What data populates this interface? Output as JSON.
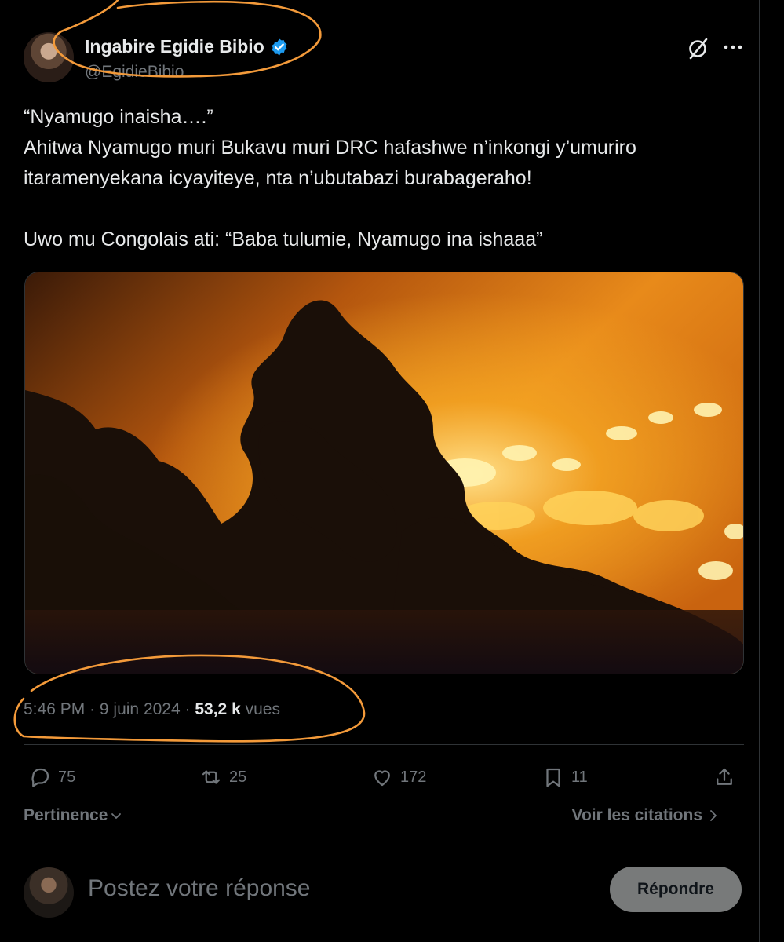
{
  "tweet": {
    "author": {
      "display_name": "Ingabire Egidie Bibio",
      "handle": "@EgidieBibio",
      "verified": true,
      "verified_color": "#1d9bf0"
    },
    "text_lines": [
      "“Nyamugo inaisha….”",
      "Ahitwa Nyamugo muri Bukavu muri DRC hafashwe n’inkongi y’umuriro",
      "itaramenyekana icyayiteye, nta n’ubutabazi burabageraho!",
      "Uwo mu Congolais ati: “Baba tulumie, Nyamugo ina ishaaa”"
    ],
    "media": {
      "kind": "video-still",
      "description_icon": "fire-scene"
    },
    "time": "5:46 PM",
    "date": "9 juin 2024",
    "separator": "·",
    "views_count": "53,2 k",
    "views_label": "vues"
  },
  "actions": {
    "replies": "75",
    "reposts": "25",
    "likes": "172",
    "bookmarks": "11"
  },
  "sort": {
    "label": "Pertinence",
    "chevron": "⌄"
  },
  "quotes_link": {
    "label": "Voir les citations",
    "chevron": "›"
  },
  "reply_box": {
    "placeholder": "Postez votre réponse",
    "button_label": "Répondre"
  },
  "colors": {
    "background": "#000000",
    "text": "#e7e9ea",
    "muted": "#71767b",
    "annotation": "#f39a3a"
  }
}
